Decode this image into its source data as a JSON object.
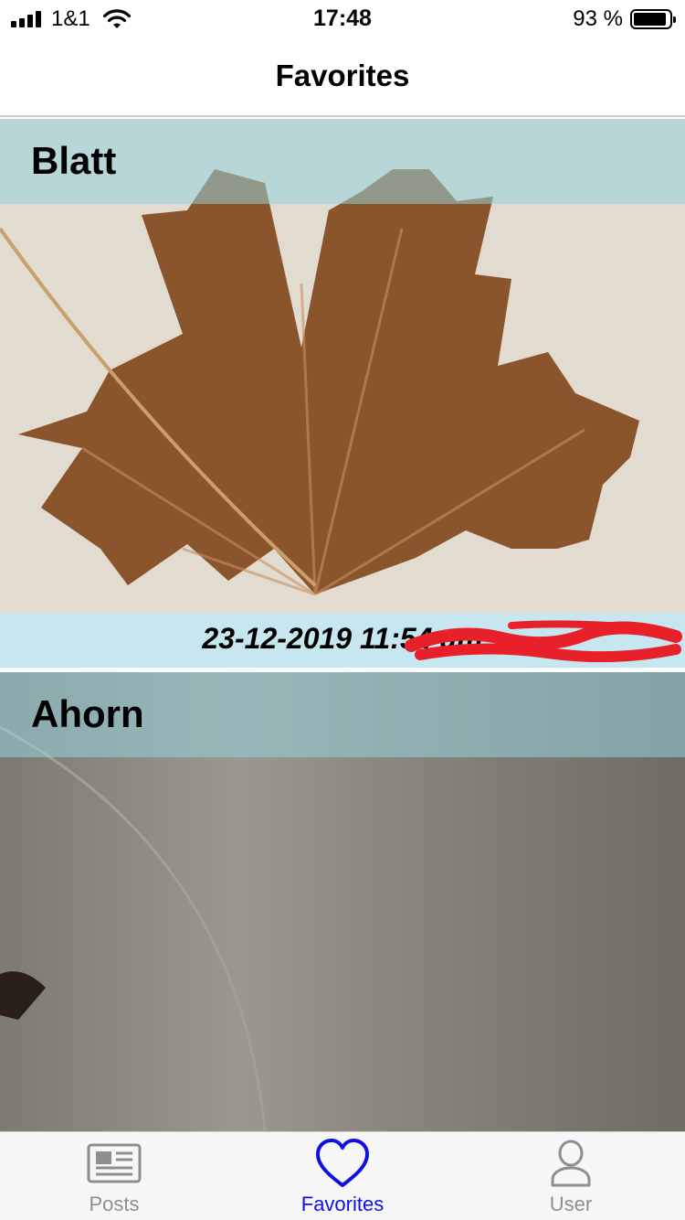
{
  "status_bar": {
    "carrier": "1&1",
    "time": "17:48",
    "battery_percent": "93 %",
    "battery_level": 0.93
  },
  "nav": {
    "title": "Favorites"
  },
  "favorites": [
    {
      "title": "Blatt",
      "date": "23-12-2019 11:54 am"
    },
    {
      "title": "Ahorn"
    }
  ],
  "tabs": [
    {
      "label": "Posts",
      "icon": "newspaper-icon",
      "active": false
    },
    {
      "label": "Favorites",
      "icon": "heart-icon",
      "active": true
    },
    {
      "label": "User",
      "icon": "user-icon",
      "active": false
    }
  ],
  "colors": {
    "accent": "#1010e6",
    "inactive_tab": "#8e8e93",
    "card_header": "#96d2dc",
    "card_footer": "#c6e7ef",
    "redaction": "#e8202a"
  }
}
